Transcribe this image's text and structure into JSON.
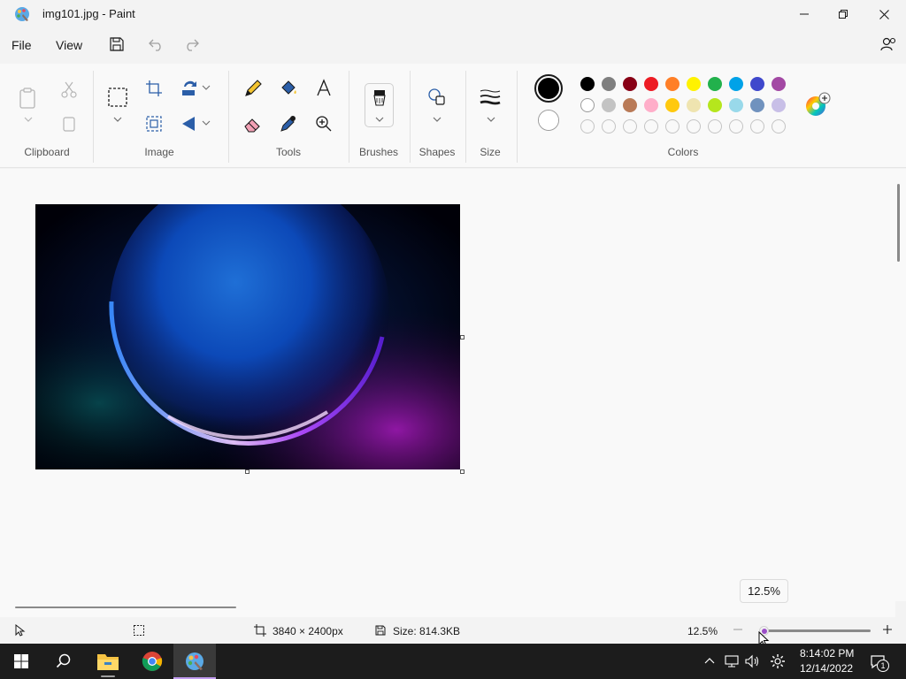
{
  "window": {
    "title": "img101.jpg - Paint"
  },
  "menu": {
    "file": "File",
    "view": "View"
  },
  "ribbon": {
    "groups": {
      "clipboard": "Clipboard",
      "image": "Image",
      "tools": "Tools",
      "brushes": "Brushes",
      "shapes": "Shapes",
      "size": "Size",
      "colors": "Colors"
    }
  },
  "colors": {
    "primary": "#000000",
    "secondary": "#ffffff",
    "palette_row1": [
      "#000000",
      "#7f7f7f",
      "#880015",
      "#ed1c24",
      "#ff7f27",
      "#fff200",
      "#22b14c",
      "#00a2e8",
      "#3f48cc",
      "#a349a4"
    ],
    "palette_row2": [
      "#ffffff",
      "#c3c3c3",
      "#b97a57",
      "#ffaec9",
      "#ffc90e",
      "#efe4b0",
      "#b5e61d",
      "#99d9ea",
      "#7092be",
      "#c8bfe7"
    ]
  },
  "status": {
    "image_dimensions": "3840 × 2400px",
    "file_size": "Size: 814.3KB",
    "zoom": "12.5%",
    "zoom_tooltip": "12.5%"
  },
  "taskbar": {
    "time": "8:14:02 PM",
    "date": "12/14/2022",
    "notification_count": "1"
  }
}
